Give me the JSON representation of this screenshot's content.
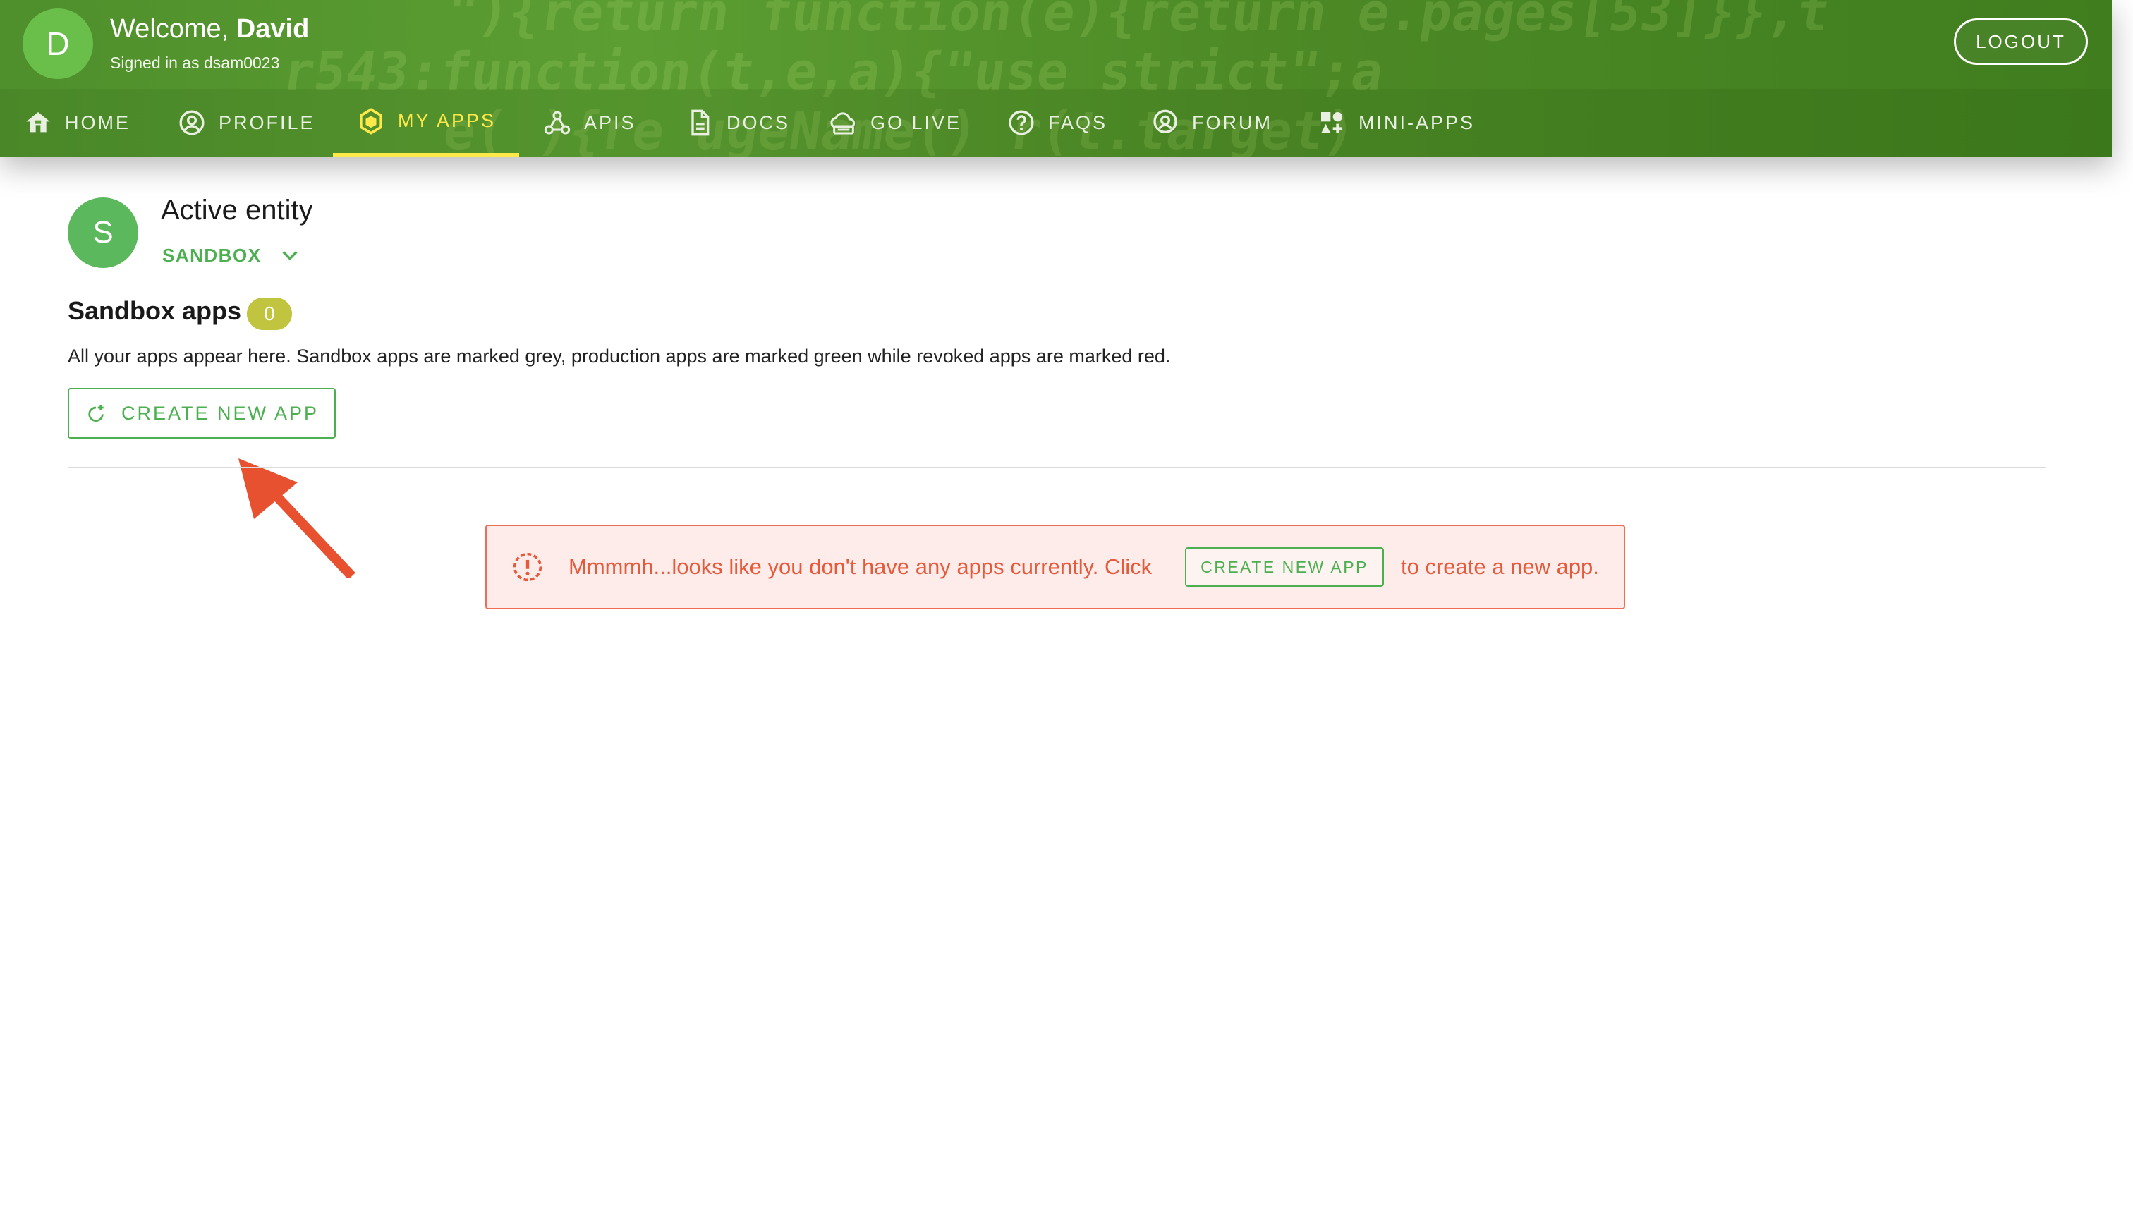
{
  "header": {
    "avatar_letter": "D",
    "welcome_prefix": "Welcome, ",
    "user_name": "David",
    "signed_in_text": "Signed in as dsam0023",
    "logout_label": "LOGOUT",
    "accent_color": "#ffe94a",
    "bg_code_lines": [
      "\"){return function(e){return  e.pages[53]}},t",
      "  r543:function(t,e,a){\"use strict\";a",
      "    e(   ){re   ugeName()  r(t.target)"
    ]
  },
  "nav": {
    "items": [
      {
        "label": "HOME",
        "icon": "home-icon"
      },
      {
        "label": "PROFILE",
        "icon": "profile-icon"
      },
      {
        "label": "MY APPS",
        "icon": "my-apps-icon",
        "active": true
      },
      {
        "label": "APIS",
        "icon": "apis-icon"
      },
      {
        "label": "DOCS",
        "icon": "docs-icon"
      },
      {
        "label": "GO LIVE",
        "icon": "go-live-icon"
      },
      {
        "label": "FAQS",
        "icon": "faqs-icon"
      },
      {
        "label": "FORUM",
        "icon": "forum-icon"
      },
      {
        "label": "MINI-APPS",
        "icon": "mini-apps-icon"
      }
    ]
  },
  "entity": {
    "avatar_letter": "S",
    "label": "Active entity",
    "selected": "SANDBOX"
  },
  "apps": {
    "title": "Sandbox apps",
    "count": "0",
    "description": "All your apps appear here. Sandbox apps are marked grey, production apps are marked green while revoked apps are marked red.",
    "create_label": "CREATE NEW APP"
  },
  "alert": {
    "text_before": "Mmmmh...looks like you don't have any apps currently. Click",
    "button_label": "CREATE NEW APP",
    "text_after": "to create a new app.",
    "color": "#e65a3c"
  },
  "colors": {
    "brand_green": "#4caf50",
    "header_green": "#5c9e32",
    "arrow": "#e8512f"
  }
}
